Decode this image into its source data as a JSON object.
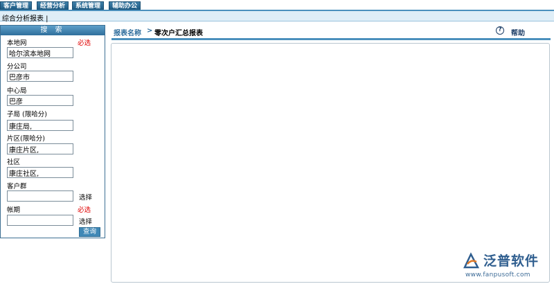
{
  "top_tabs": [
    {
      "label": "客户管理"
    },
    {
      "label": "经营分析"
    },
    {
      "label": "系统管理"
    },
    {
      "label": "辅助办公"
    }
  ],
  "subnav": {
    "label": "综合分析报表 |"
  },
  "sidebar": {
    "title": "搜 索",
    "required_label": "必选",
    "select_label": "选择",
    "query_button": "查询",
    "fields": {
      "local_net": {
        "label": "本地网",
        "value": "哈尔滨本地网"
      },
      "branch": {
        "label": "分公司",
        "value": "巴彦市"
      },
      "center": {
        "label": "中心局",
        "value": "巴彦"
      },
      "sub_bureau": {
        "label": "子局 (限哈分)",
        "value": "康庄局,"
      },
      "area": {
        "label": "片区(限哈分)",
        "value": "康庄片区,"
      },
      "community": {
        "label": "社区",
        "value": "康庄社区,"
      },
      "customer_group": {
        "label": "客户群",
        "value": ""
      },
      "period": {
        "label": "帐期",
        "value": ""
      }
    }
  },
  "breadcrumb": {
    "name_label": "报表名称",
    "separator": ">",
    "report_name": "零次户汇总报表",
    "help_label": "帮助"
  },
  "watermark": {
    "brand": "泛普软件",
    "url": "www.fanpusoft.com"
  }
}
